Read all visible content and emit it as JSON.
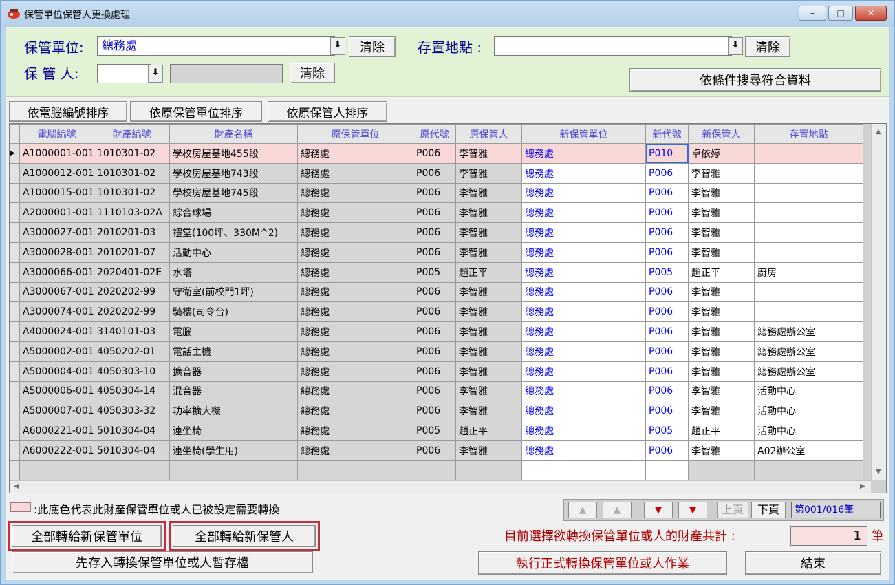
{
  "window": {
    "title": "保管單位保管人更換處理",
    "minimize": "–",
    "maximize": "□",
    "close": "✕"
  },
  "filters": {
    "unit_label": "保管單位:",
    "unit_value": "總務處",
    "unit_clear": "清除",
    "location_label": "存置地點 :",
    "location_value": "",
    "location_clear": "清除",
    "keeper_label": "保 管 人:",
    "keeper_code": "",
    "keeper_name": "",
    "keeper_clear": "清除",
    "search_button": "依條件搜尋符合資料",
    "dropdown_glyph": "⬇"
  },
  "sort_buttons": {
    "by_computer_no": "依電腦編號排序",
    "by_unit": "依原保管單位排序",
    "by_keeper": "依原保管人排序"
  },
  "grid": {
    "columns": [
      "電腦編號",
      "財產編號",
      "財產名稱",
      "原保管單位",
      "原代號",
      "原保管人",
      "新保管單位",
      "新代號",
      "新保管人",
      "存置地點"
    ],
    "rows": [
      [
        "A1000001-001",
        "1010301-02",
        "學校房屋基地455段",
        "總務處",
        "P006",
        "李智雅",
        "總務處",
        "P010",
        "卓依婷",
        ""
      ],
      [
        "A1000012-001",
        "1010301-02",
        "學校房屋基地743段",
        "總務處",
        "P006",
        "李智雅",
        "總務處",
        "P006",
        "李智雅",
        ""
      ],
      [
        "A1000015-001",
        "1010301-02",
        "學校房屋基地745段",
        "總務處",
        "P006",
        "李智雅",
        "總務處",
        "P006",
        "李智雅",
        ""
      ],
      [
        "A2000001-001",
        "1110103-02A",
        "綜合球場",
        "總務處",
        "P006",
        "李智雅",
        "總務處",
        "P006",
        "李智雅",
        ""
      ],
      [
        "A3000027-001",
        "2010201-03",
        "禮堂(100坪、330M^2)",
        "總務處",
        "P006",
        "李智雅",
        "總務處",
        "P006",
        "李智雅",
        ""
      ],
      [
        "A3000028-001",
        "2010201-07",
        "活動中心",
        "總務處",
        "P006",
        "李智雅",
        "總務處",
        "P006",
        "李智雅",
        ""
      ],
      [
        "A3000066-001",
        "2020401-02E",
        "水塔",
        "總務處",
        "P005",
        "趙正平",
        "總務處",
        "P005",
        "趙正平",
        "廚房"
      ],
      [
        "A3000067-001",
        "2020202-99",
        "守衛室(前校門1坪)",
        "總務處",
        "P006",
        "李智雅",
        "總務處",
        "P006",
        "李智雅",
        ""
      ],
      [
        "A3000074-001",
        "2020202-99",
        "騎樓(司令台)",
        "總務處",
        "P006",
        "李智雅",
        "總務處",
        "P006",
        "李智雅",
        ""
      ],
      [
        "A4000024-001",
        "3140101-03",
        "電腦",
        "總務處",
        "P006",
        "李智雅",
        "總務處",
        "P006",
        "李智雅",
        "總務處辦公室"
      ],
      [
        "A5000002-001",
        "4050202-01",
        "電話主機",
        "總務處",
        "P006",
        "李智雅",
        "總務處",
        "P006",
        "李智雅",
        "總務處辦公室"
      ],
      [
        "A5000004-001",
        "4050303-10",
        "擴音器",
        "總務處",
        "P006",
        "李智雅",
        "總務處",
        "P006",
        "李智雅",
        "總務處辦公室"
      ],
      [
        "A5000006-001",
        "4050304-14",
        "混音器",
        "總務處",
        "P006",
        "李智雅",
        "總務處",
        "P006",
        "李智雅",
        "活動中心"
      ],
      [
        "A5000007-001",
        "4050303-32",
        "功率擴大機",
        "總務處",
        "P006",
        "李智雅",
        "總務處",
        "P006",
        "李智雅",
        "活動中心"
      ],
      [
        "A6000221-001",
        "5010304-04",
        "連坐椅",
        "總務處",
        "P005",
        "趙正平",
        "總務處",
        "P005",
        "趙正平",
        "活動中心"
      ],
      [
        "A6000222-001",
        "5010304-04",
        "連坐椅(學生用)",
        "總務處",
        "P006",
        "李智雅",
        "總務處",
        "P006",
        "李智雅",
        "A02辦公室"
      ]
    ]
  },
  "legend": {
    "text": ":此底色代表此財產保管單位或人已被設定需要轉換",
    "highlight_color": "#f9d8d8"
  },
  "nav": {
    "first": "▲",
    "prev": "▲",
    "next": "▼",
    "last": "▼",
    "prev_page": "上頁",
    "next_page": "下頁",
    "record": "第001/016筆"
  },
  "actions": {
    "all_to_new_unit": "全部轉給新保管單位",
    "all_to_new_keeper": "全部轉給新保管人",
    "save_temp": "先存入轉換保管單位或人暫存檔",
    "count_label": "目前選擇欲轉換保管單位或人的財產共計 :",
    "count_value": "1",
    "count_unit": "筆",
    "execute": "執行正式轉換保管單位或人作業",
    "exit": "結束"
  }
}
